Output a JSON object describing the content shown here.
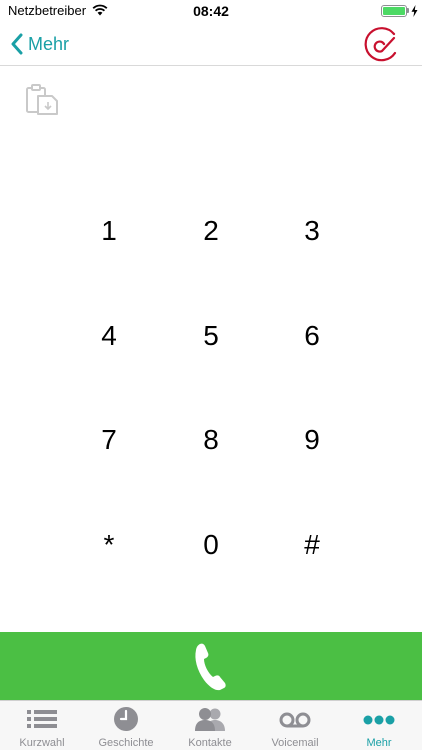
{
  "status_bar": {
    "carrier": "Netzbetreiber",
    "time": "08:42",
    "battery_level": 1.0
  },
  "nav": {
    "back_label": "Mehr",
    "accent_color": "#1aa0a6",
    "logo_color": "#c8102e"
  },
  "keypad": {
    "keys": [
      "1",
      "2",
      "3",
      "4",
      "5",
      "6",
      "7",
      "8",
      "9",
      "*",
      "0",
      "#"
    ]
  },
  "call_bar": {
    "color": "#4bbf44",
    "icon": "phone-icon"
  },
  "tabs": [
    {
      "label": "Kurzwahl",
      "icon": "list-icon",
      "active": false
    },
    {
      "label": "Geschichte",
      "icon": "clock-icon",
      "active": false
    },
    {
      "label": "Kontakte",
      "icon": "contacts-icon",
      "active": false
    },
    {
      "label": "Voicemail",
      "icon": "voicemail-icon",
      "active": false
    },
    {
      "label": "Mehr",
      "icon": "more-icon",
      "active": true
    }
  ]
}
